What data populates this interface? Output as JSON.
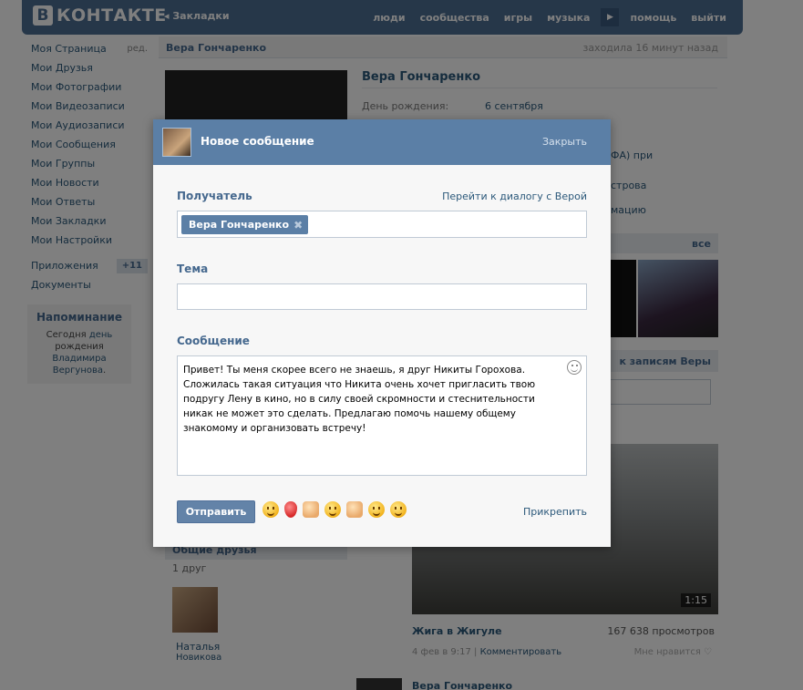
{
  "brand": {
    "logo_letter": "В",
    "logo_text": "КОНТАКТЕ"
  },
  "topbar": {
    "bookmarks": "◂ Закладки",
    "nav": [
      "люди",
      "сообщества",
      "игры",
      "музыка",
      "помощь",
      "выйти"
    ]
  },
  "leftnav": {
    "items": [
      {
        "label": "Моя Страница",
        "extra": "ред."
      },
      {
        "label": "Мои Друзья"
      },
      {
        "label": "Мои Фотографии"
      },
      {
        "label": "Мои Видеозаписи"
      },
      {
        "label": "Мои Аудиозаписи"
      },
      {
        "label": "Мои Сообщения"
      },
      {
        "label": "Мои Группы"
      },
      {
        "label": "Мои Новости"
      },
      {
        "label": "Мои Ответы"
      },
      {
        "label": "Мои Закладки"
      },
      {
        "label": "Мои Настройки"
      }
    ],
    "apps": {
      "label": "Приложения",
      "badge": "+11"
    },
    "docs": "Документы"
  },
  "reminder": {
    "title": "Напоминание",
    "text1": "Сегодня",
    "link1": "день",
    "text2": "рождения",
    "link2": "Владимира Вергунова",
    "end": "."
  },
  "profile": {
    "header_name": "Вера Гончаренко",
    "status": "заходила 16 минут назад",
    "name": "Вера Гончаренко",
    "bday_label": "День рождения:",
    "bday_value": "6 сентября",
    "frag1": "ФА) при",
    "frag2": "строва",
    "frag3": "мацию",
    "photos_all": "все",
    "wall_link": "к записям Веры"
  },
  "friends": {
    "title": "Общие друзья",
    "count": "1 друг",
    "friend_first": "Наталья",
    "friend_last": "Новикова"
  },
  "video": {
    "duration": "1:15",
    "title": "Жига в Жигуле",
    "views": "167 638 просмотров",
    "meta": "4 фев в 9:17",
    "comment": "Комментировать",
    "like": "Мне нравится ♡"
  },
  "post": {
    "name": "Вера Гончаренко"
  },
  "modal": {
    "title": "Новое сообщение",
    "close": "Закрыть",
    "recipient_label": "Получатель",
    "goto_dialog": "Перейти к диалогу с Верой",
    "recipient_name": "Вера Гончаренко",
    "recipient_remove": "✖",
    "subject_label": "Тема",
    "subject_value": "",
    "message_label": "Сообщение",
    "message_text": "Привет! Ты меня скорее всего не знаешь, я друг Никиты Горохова. Сложилась такая ситуация что Никита очень хочет пригласить твою подругу Лену в кино, но в силу своей скромности и стеснительности никак не может это сделать. Предлагаю помочь нашему общему знакомому и организовать встречу!",
    "send": "Отправить",
    "attach": "Прикрепить",
    "emojis": [
      "laughing-emoji",
      "balloon-emoji",
      "thumbs-up-emoji",
      "winking-tongue-emoji",
      "fist-emoji",
      "wink-emoji",
      "grin-emoji"
    ]
  }
}
